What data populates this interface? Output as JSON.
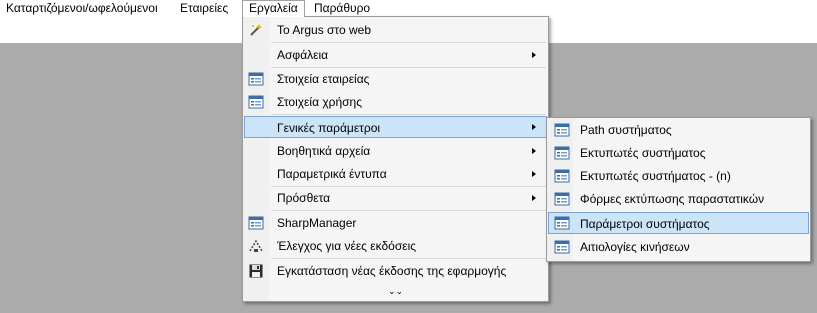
{
  "menubar": {
    "items": [
      "Καταρτιζόμενοι/ωφελούμενοι",
      "Εταιρείες",
      "Εργαλεία",
      "Παράθυρο"
    ]
  },
  "tools_menu": {
    "items": [
      {
        "label": "To Argus στο web",
        "icon": "wand-icon"
      },
      {
        "label": "Ασφάλεια",
        "submenu": true
      },
      {
        "label": "Στοιχεία εταιρείας",
        "icon": "form-icon"
      },
      {
        "label": "Στοιχεία χρήσης",
        "icon": "form-icon"
      },
      {
        "label": "Γενικές παράμετροι",
        "submenu": true,
        "highlighted": true
      },
      {
        "label": "Βοηθητικά αρχεία",
        "submenu": true
      },
      {
        "label": "Παραμετρικά έντυπα",
        "submenu": true
      },
      {
        "label": "Πρόσθετα",
        "submenu": true
      },
      {
        "label": "SharpManager",
        "icon": "form-icon"
      },
      {
        "label": "Έλεγχος για νέες εκδόσεις",
        "icon": "update-check-icon"
      },
      {
        "label": "Εγκατάσταση νέας έκδοσης της εφαρμογής",
        "icon": "floppy-disk-icon"
      }
    ],
    "more_glyph": "⌄⌄"
  },
  "general_params_submenu": {
    "items": [
      {
        "label": "Path συστήματος",
        "icon": "form-icon"
      },
      {
        "label": "Εκτυπωτές συστήματος",
        "icon": "form-icon"
      },
      {
        "label": "Εκτυπωτές συστήματος - (n)",
        "icon": "form-icon"
      },
      {
        "label": "Φόρμες εκτύπωσης παραστατικών",
        "icon": "form-icon"
      },
      {
        "label": "Παράμετροι συστήματος",
        "icon": "form-icon",
        "highlighted": true
      },
      {
        "label": "Αιτιολογίες κινήσεων",
        "icon": "form-icon"
      }
    ]
  },
  "colors": {
    "highlight_bg": "#cce4f7",
    "highlight_border": "#7da2ce",
    "workspace": "#ababab"
  }
}
